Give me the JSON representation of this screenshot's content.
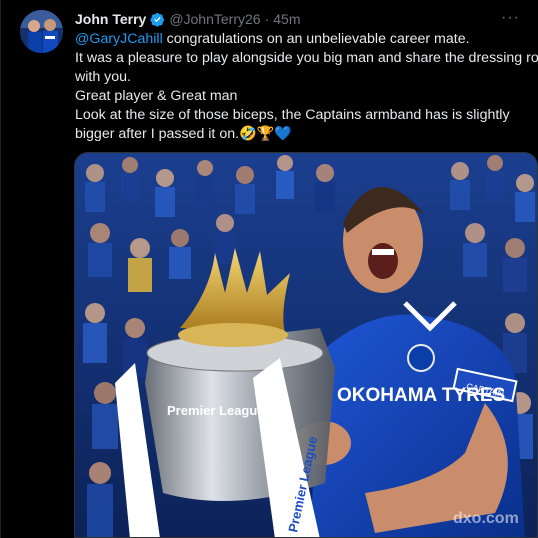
{
  "tweet": {
    "display_name": "John Terry",
    "handle": "@JohnTerry26",
    "separator": "·",
    "time": "45m",
    "more_label": "···",
    "mention": "@GaryJCahill",
    "line1_rest": " congratulations on an unbelievable career mate.",
    "line2": "It was a pleasure to play alongside you big man and share the dressing room",
    "line3": "with you.",
    "line4": "Great player & Great man",
    "line5": "Look at the size of those biceps, the Captains armband has is slightly",
    "line6": "bigger after I passed it on.🤣🏆💙"
  },
  "media": {
    "description": "Gary Cahill celebrating with the Premier League trophy",
    "trophy_ribbon_text": "Premier League",
    "trophy_text": "Premier League",
    "shirt_sponsor": "OKOHAMA TYRES",
    "sleeve_badge": "CAPTAIN",
    "watermark": "dxo.com"
  },
  "colors": {
    "background": "#000000",
    "text": "#e7e9ea",
    "secondary": "#71767b",
    "link": "#1d9bf0",
    "verified": "#1d9bf0",
    "chelsea_blue": "#0a3ea8"
  }
}
